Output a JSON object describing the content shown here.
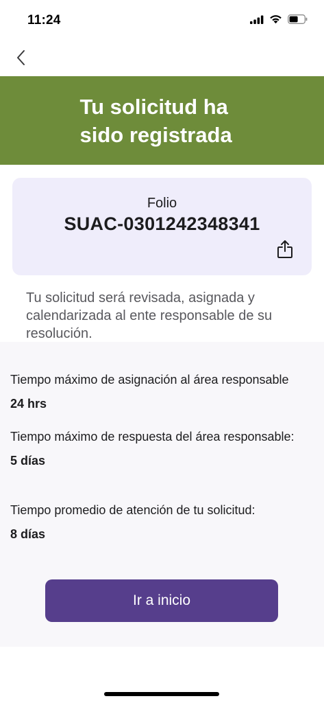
{
  "status_bar": {
    "time": "11:24",
    "icons": [
      "cellular-signal-icon",
      "wifi-icon",
      "battery-icon"
    ]
  },
  "nav": {
    "back_icon": "chevron-left-icon"
  },
  "banner": {
    "title": "Tu solicitud ha sido registrada",
    "background_color": "#6e8c3a"
  },
  "folio_card": {
    "label": "Folio",
    "number": "SUAC-0301242348341",
    "share_icon": "share-icon",
    "background_color": "#efedfb"
  },
  "description": "Tu solicitud será revisada, asignada y calendarizada al ente responsable de su resolución.",
  "info": [
    {
      "label": "Tiempo máximo de asignación al área responsable",
      "value": "24 hrs"
    },
    {
      "label": "Tiempo máximo de respuesta del área responsable:",
      "value": "5 días"
    },
    {
      "label": "Tiempo promedio de atención de tu solicitud:",
      "value": "8 días"
    }
  ],
  "primary_button": {
    "label": "Ir a inicio",
    "background_color": "#563e8c"
  }
}
